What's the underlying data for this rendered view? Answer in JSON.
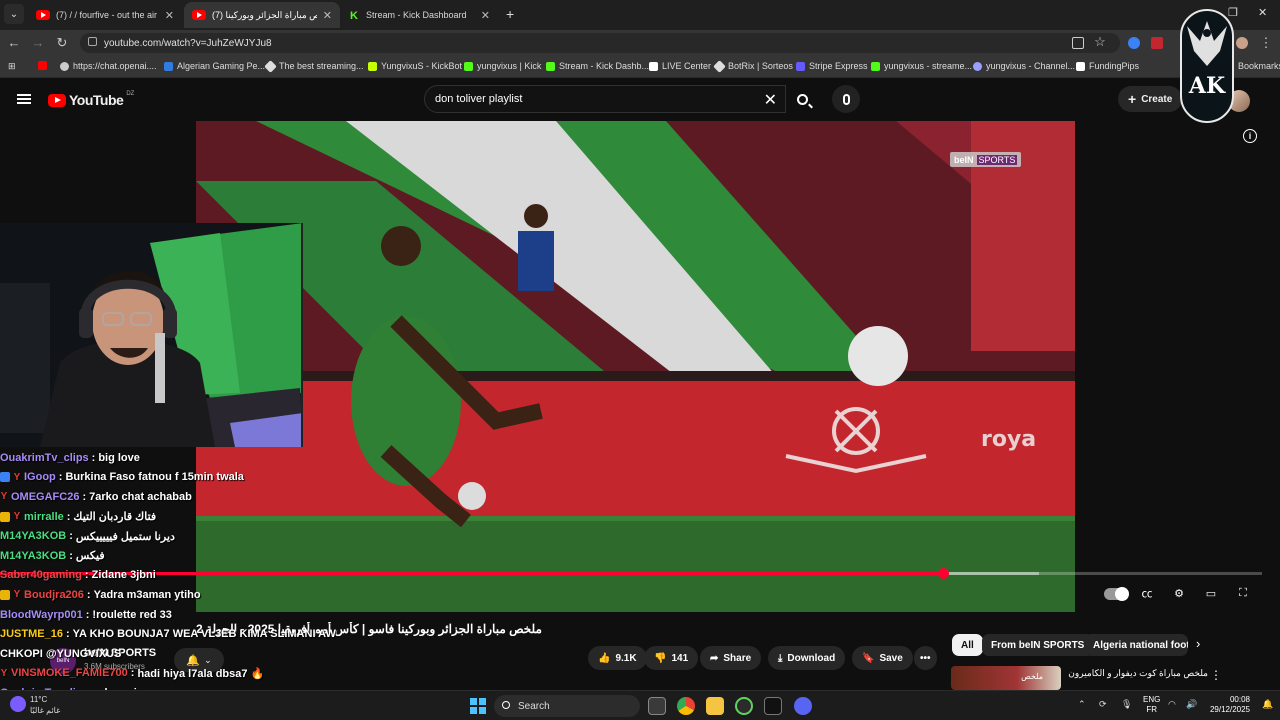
{
  "browser": {
    "tabs": [
      {
        "title": "(7) / / fourfive - out the air ( sk",
        "icon": "youtube-icon"
      },
      {
        "title": "(7) ملخص مباراة الجزائر وبوركينا",
        "icon": "youtube-icon"
      },
      {
        "title": "Stream - Kick Dashboard",
        "icon": "kick-icon"
      }
    ],
    "url": "youtube.com/watch?v=JuhZeWJYJu8",
    "bookmarks": [
      {
        "label": "",
        "color": "#ff0000"
      },
      {
        "label": "https://chat.openai....",
        "color": "#cccccc"
      },
      {
        "label": "Algerian Gaming Pe...",
        "color": "#2f7de1"
      },
      {
        "label": "The best streaming...",
        "color": "#dddddd"
      },
      {
        "label": "YungvixuS - KickBot",
        "color": "#c6ff00"
      },
      {
        "label": "yungvixus | Kick",
        "color": "#53fc18"
      },
      {
        "label": "Stream - Kick Dashb...",
        "color": "#53fc18"
      },
      {
        "label": "LIVE Center",
        "color": "#ffffff"
      },
      {
        "label": "BotRix | Sorteos",
        "color": "#dddddd"
      },
      {
        "label": "Stripe Express",
        "color": "#635bff"
      },
      {
        "label": "yungvixus - streame...",
        "color": "#53fc18"
      },
      {
        "label": "yungvixus - Channel...",
        "color": "#9aa0ff"
      },
      {
        "label": "FundingPips",
        "color": "#ffffff"
      },
      {
        "label": "Bookmarks",
        "color": "#f5c542"
      }
    ]
  },
  "youtube": {
    "logo_text": "YouTube",
    "country_code": "DZ",
    "search_value": "don toliver playlist",
    "create_label": "Create",
    "video": {
      "overlay_brand": "beIN",
      "overlay_sports": "SPORTS",
      "progress": 0.747,
      "buffered_to": 0.823
    },
    "title": "ملخص مباراة الجزائر وبوركينا فاسو | كأس أمم أفريقيا 2025 - الجولة 2",
    "channel": {
      "name": "beIN SPORTS",
      "subs": "3.6M subscribers",
      "avatar_text": "beIN"
    },
    "actions": {
      "likes": "9.1K",
      "dislikes": "141",
      "share": "Share",
      "download": "Download",
      "save": "Save",
      "more": "•••"
    },
    "chips": [
      "All",
      "From beIN SPORTS",
      "Algeria national footb"
    ],
    "recommendation": {
      "title": "ملخص مباراة كوت ديفوار و الكاميرون | كأس أمم أفريقيا 2025 - الجولة 2",
      "thumb_text": "ملخص"
    }
  },
  "chat": [
    {
      "user": "OuakrimTv_clips",
      "color": "#a78bfa",
      "msg": "big love",
      "badge": ""
    },
    {
      "user": "IGoop",
      "color": "#a78bfa",
      "msg": "Burkina Faso fatnou f 15min twala",
      "badge": "#3b82f6",
      "y": true
    },
    {
      "user": "OMEGAFC26",
      "color": "#a78bfa",
      "msg": "7arko chat achabab",
      "badge": "",
      "y": true
    },
    {
      "user": "mirralle",
      "color": "#4ade80",
      "msg": "فتاك قاردبان التيك",
      "badge": "#eab308",
      "y": true
    },
    {
      "user": "M14YA3KOB",
      "color": "#4ade80",
      "msg": "ديرنا ستميل فيييييكس",
      "badge": ""
    },
    {
      "user": "M14YA3KOB",
      "color": "#4ade80",
      "msg": "فيكس",
      "badge": ""
    },
    {
      "user": "Saber40gaming",
      "color": "#ef4444",
      "msg": "Zidane 3jbni",
      "badge": ""
    },
    {
      "user": "Boudjra206",
      "color": "#ef4444",
      "msg": "Yadra m3aman ytiho",
      "badge": "#eab308",
      "y": true
    },
    {
      "user": "BloodWayrp001",
      "color": "#a78bfa",
      "msg": "!roulette red 33",
      "badge": ""
    },
    {
      "user": "JUSTME_16",
      "color": "#facc15",
      "msg": "YA KHO BOUNJA7 WEA VL3EB KIMA SLIMANI AW",
      "badge": ""
    },
    {
      "user": "",
      "color": "#ffffff",
      "msg": "CHKOPI @YUNGVIXUS",
      "badge": ""
    },
    {
      "user": "VINSMOKE_FAMIE700",
      "color": "#ef4444",
      "msg": "hadi hiya l7ala dbsa7 🔥",
      "badge": "",
      "y": true
    },
    {
      "user": "OuakrimTv_clips",
      "color": "#a78bfa",
      "msg": "champion",
      "badge": ""
    }
  ],
  "stream_logo": "AK",
  "taskbar": {
    "weather_temp": "11°C",
    "weather_desc": "غائم غالبًا",
    "search_label": "Search",
    "lang_top": "ENG",
    "lang_bottom": "FR",
    "time": "00:08",
    "date": "29/12/2025"
  }
}
